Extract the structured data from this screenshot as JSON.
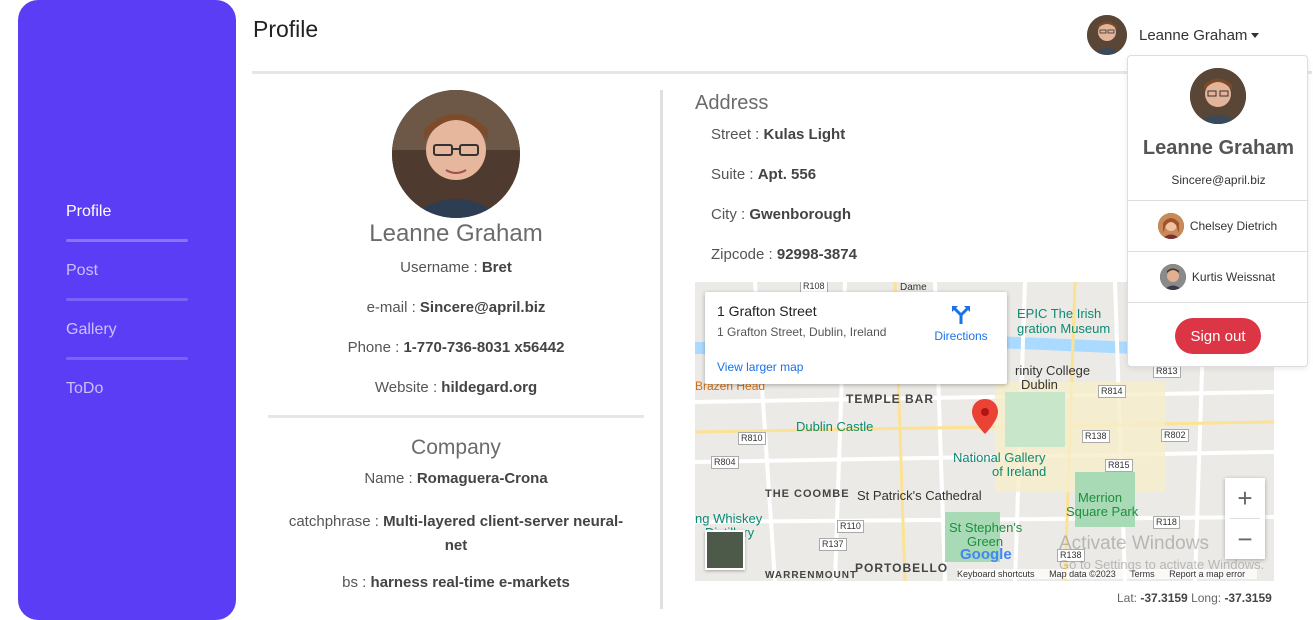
{
  "sidebar": {
    "items": [
      {
        "label": "Profile",
        "active": true
      },
      {
        "label": "Post",
        "active": false
      },
      {
        "label": "Gallery",
        "active": false
      },
      {
        "label": "ToDo",
        "active": false
      }
    ]
  },
  "header": {
    "title": "Profile",
    "user_name": "Leanne Graham"
  },
  "profile": {
    "name": "Leanne Graham",
    "username_label": "Username : ",
    "username": "Bret",
    "email_label": "e-mail : ",
    "email": "Sincere@april.biz",
    "phone_label": "Phone : ",
    "phone": "1-770-736-8031 x56442",
    "website_label": "Website : ",
    "website": "hildegard.org"
  },
  "company": {
    "title": "Company",
    "name_label": "Name : ",
    "name": "Romaguera-Crona",
    "catchphrase_label": "catchphrase : ",
    "catchphrase_line1": "Multi-layered client-server neural-",
    "catchphrase_line2": "net",
    "bs_label": "bs : ",
    "bs": "harness real-time e-markets"
  },
  "address": {
    "title": "Address",
    "street_label": "Street : ",
    "street": "Kulas Light",
    "suite_label": "Suite : ",
    "suite": "Apt. 556",
    "city_label": "City : ",
    "city": "Gwenborough",
    "zipcode_label": "Zipcode : ",
    "zipcode": "92998-3874"
  },
  "map": {
    "place_title": "1 Grafton Street",
    "place_address": "1 Grafton Street, Dublin, Ireland",
    "directions_label": "Directions",
    "larger_map_label": "View larger map",
    "labels": {
      "epic": "EPIC The Irish",
      "emigration": "gration Museum",
      "trinity1": "rinity College",
      "trinity2": "Dublin",
      "temple_bar": "TEMPLE BAR",
      "brazen": "Brazen Head",
      "dublin_castle": "Dublin Castle",
      "gallery1": "National Gallery",
      "gallery2": "of Ireland",
      "coombe": "THE COOMBE",
      "patricks": "St Patrick's Cathedral",
      "merrion1": "Merrion",
      "merrion2": "Square Park",
      "whiskey1": "ng Whiskey",
      "whiskey2": "Distillery",
      "stephens1": "St Stephen's",
      "stephens2": "Green",
      "portobello": "PORTOBELLO",
      "warrenmount": "WARRENMOUNT",
      "dame": "Dame"
    },
    "road_tags": [
      "R108",
      "R810",
      "R804",
      "R110",
      "R137",
      "R814",
      "R813",
      "R138",
      "R802",
      "R815",
      "R118",
      "R138"
    ],
    "footer": {
      "shortcuts": "Keyboard shortcuts",
      "data": "Map data ©2023",
      "terms": "Terms",
      "report": "Report a map error"
    },
    "google": "Google",
    "zoom_in": "+",
    "zoom_out": "−"
  },
  "watermark": {
    "line1": "Activate Windows",
    "line2": "Go to Settings to activate Windows."
  },
  "coords": {
    "lat_label": "Lat: ",
    "lat": "-37.3159",
    "long_label": " Long: ",
    "long": "-37.3159"
  },
  "dropdown": {
    "name": "Leanne Graham",
    "email": "Sincere@april.biz",
    "accounts": [
      {
        "name": "Chelsey Dietrich"
      },
      {
        "name": "Kurtis Weissnat"
      }
    ],
    "signout_label": "Sign out"
  },
  "colors": {
    "sidebar": "#5b3df5",
    "signout": "#dc3545",
    "link": "#1a73e8"
  }
}
